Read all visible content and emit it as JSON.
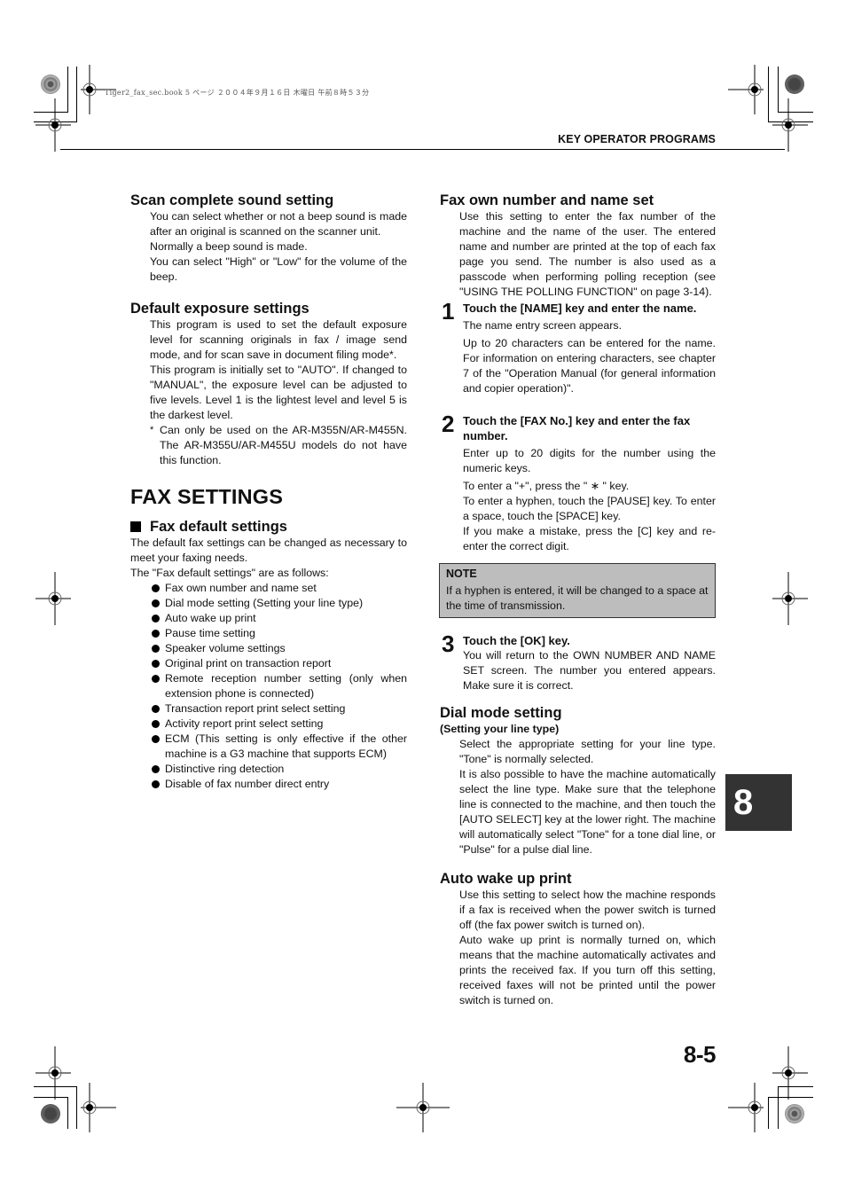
{
  "print_marks": {
    "file_stamp": "Tiger2_fax_sec.book  5 ページ  ２００４年９月１６日  木曜日  午前８時５３分"
  },
  "header": {
    "running_head": "KEY OPERATOR PROGRAMS"
  },
  "left_column": {
    "scan_complete": {
      "title": "Scan complete sound setting",
      "paragraphs": [
        "You can select whether or not a beep sound is made after an original is scanned on the scanner unit.",
        "Normally a beep sound is made.",
        "You can select \"High\" or \"Low\" for the volume of the beep."
      ]
    },
    "default_exposure": {
      "title": "Default exposure settings",
      "paragraphs": [
        "This program is used to set the default exposure level for scanning originals in fax / image send mode, and for scan save in document filing mode*.",
        "This program is initially set to \"AUTO\". If changed to \"MANUAL\", the exposure level can be adjusted to five levels. Level 1 is the lightest level and level 5 is the darkest level."
      ],
      "footnote_mark": "*",
      "footnote": "Can only be used on the AR-M355N/AR-M455N. The AR-M355U/AR-M455U models do not have this function."
    },
    "section_title": "FAX SETTINGS",
    "fax_default": {
      "title": "Fax default settings",
      "intro": [
        "The default fax settings can be changed as necessary to meet your faxing needs.",
        "The \"Fax default settings\" are as follows:"
      ],
      "items": [
        "Fax own number and name set",
        "Dial mode setting (Setting your line type)",
        "Auto wake up print",
        "Pause time setting",
        "Speaker volume settings",
        "Original print on transaction report",
        "Remote reception number setting (only when extension phone is connected)",
        "Transaction report print select setting",
        "Activity report print select setting",
        "ECM (This setting is only effective if the other machine is a G3 machine that supports ECM)",
        "Distinctive ring detection",
        "Disable of fax number direct entry"
      ]
    }
  },
  "right_column": {
    "fax_own_number": {
      "title": "Fax own number and name set",
      "paragraph": "Use this setting to enter the fax number of the machine and the name of the user. The entered name and number are printed at the top of each fax page you send. The number is also used as a passcode when performing polling reception (see \"USING THE POLLING FUNCTION\" on page 3-14).",
      "steps": [
        {
          "num": "1",
          "title": "Touch the [NAME] key and enter the name.",
          "paragraphs": [
            "The name entry screen appears.",
            "Up to 20 characters can be entered for the name. For information on entering characters, see chapter 7 of the \"Operation Manual (for general information and copier operation)\"."
          ]
        },
        {
          "num": "2",
          "title": "Touch the [FAX No.] key and enter the fax number.",
          "paragraphs": [
            "Enter up to 20 digits for the number using the numeric keys.",
            "To enter a \"+\", press the \" ∗ \" key.",
            "To enter a hyphen, touch the [PAUSE] key. To enter a space, touch the [SPACE] key.",
            "If you make a mistake, press the [C] key and re-enter the correct digit."
          ]
        },
        {
          "num": "3",
          "title": "Touch the [OK] key.",
          "paragraphs": [
            "You will return to the OWN NUMBER AND NAME SET screen. The number you entered appears. Make sure it is correct."
          ]
        }
      ],
      "note": {
        "label": "NOTE",
        "text": "If a hyphen is entered, it will be changed to a space at the time of transmission."
      }
    },
    "dial_mode": {
      "title": "Dial mode setting",
      "subtitle": "(Setting your line type)",
      "paragraphs": [
        "Select the appropriate setting for your line type. \"Tone\" is normally selected.",
        "It is also possible to have the machine automatically select the line type. Make sure that the telephone line is connected to the machine, and then touch the [AUTO SELECT] key at the lower right. The machine will automatically select \"Tone\" for a tone dial line, or \"Pulse\" for a pulse dial line."
      ]
    },
    "auto_wake": {
      "title": "Auto wake up print",
      "paragraphs": [
        "Use this setting to select how the machine responds if a fax is received when the power switch is turned off (the fax power switch is turned on).",
        "Auto wake up print is normally turned on, which means that the machine automatically activates and prints the received fax. If you turn off this setting, received faxes will not be printed until the power switch is turned on."
      ]
    }
  },
  "chapter_tab": "8",
  "page_number": "8-5",
  "colors": {
    "note_background": "#bdbdbd",
    "chapter_tab": "#333333",
    "text": "#111111"
  }
}
